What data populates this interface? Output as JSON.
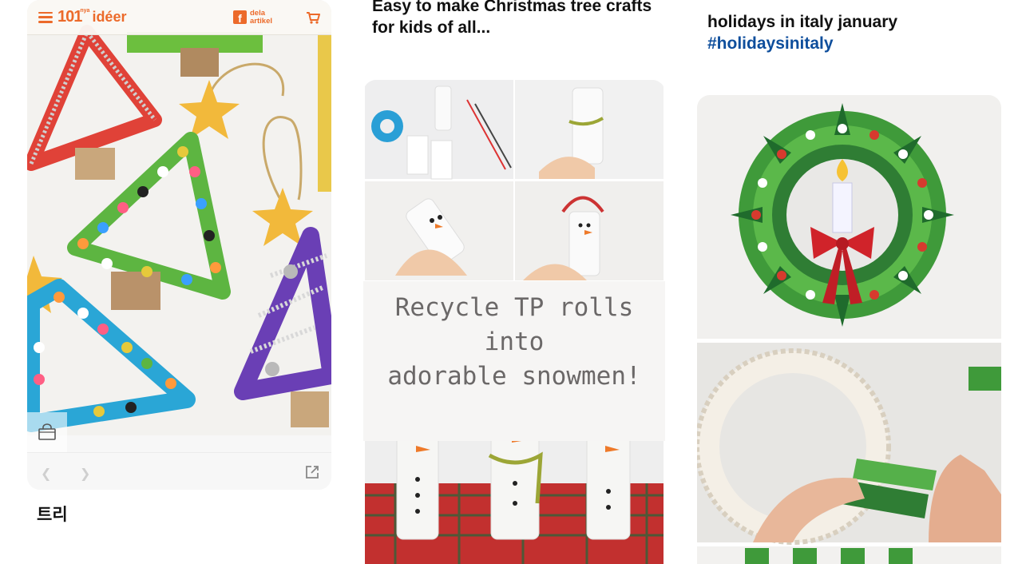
{
  "pin1": {
    "site": {
      "logo_number": "101",
      "logo_word": "idéer",
      "logo_small": "nya",
      "share_label": "dela artikel",
      "fb_glyph": "f"
    },
    "title": "트리",
    "icons": [
      "menu-icon",
      "facebook-icon",
      "cart-icon",
      "shopping-bag-icon",
      "chevron-left-icon",
      "chevron-right-icon",
      "external-link-icon"
    ]
  },
  "pin2": {
    "title": "Easy to make Christmas tree crafts for kids of all...",
    "caption_line1": "Recycle TP rolls into",
    "caption_line2": "adorable snowmen!"
  },
  "pin3": {
    "title": "holidays in italy january",
    "tag": "#holidaysinitaly"
  },
  "colors": {
    "brand_orange": "#ec6a2a",
    "hashtag_blue": "#0e4e9c",
    "title_text": "#111111"
  }
}
